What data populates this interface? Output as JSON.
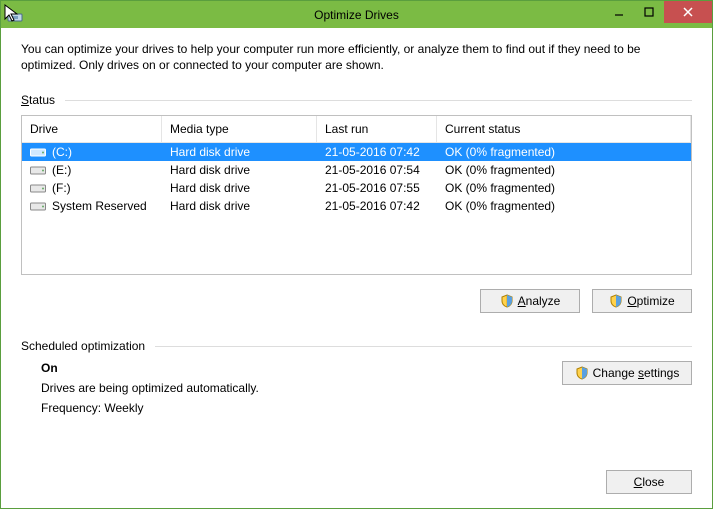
{
  "window": {
    "title": "Optimize Drives"
  },
  "intro": "You can optimize your drives to help your computer run more efficiently, or analyze them to find out if they need to be optimized. Only drives on or connected to your computer are shown.",
  "status_label": "Status",
  "columns": {
    "drive": "Drive",
    "media": "Media type",
    "last": "Last run",
    "status": "Current status"
  },
  "drives": [
    {
      "name": "(C:)",
      "media": "Hard disk drive",
      "last": "21-05-2016 07:42",
      "status": "OK (0% fragmented)",
      "selected": true
    },
    {
      "name": "(E:)",
      "media": "Hard disk drive",
      "last": "21-05-2016 07:54",
      "status": "OK (0% fragmented)",
      "selected": false
    },
    {
      "name": "(F:)",
      "media": "Hard disk drive",
      "last": "21-05-2016 07:55",
      "status": "OK (0% fragmented)",
      "selected": false
    },
    {
      "name": "System Reserved",
      "media": "Hard disk drive",
      "last": "21-05-2016 07:42",
      "status": "OK (0% fragmented)",
      "selected": false
    }
  ],
  "buttons": {
    "analyze_pre": "",
    "analyze_u": "A",
    "analyze_post": "nalyze",
    "optimize_pre": "",
    "optimize_u": "O",
    "optimize_post": "ptimize",
    "change_pre": "Change ",
    "change_u": "s",
    "change_post": "ettings",
    "close_pre": "",
    "close_u": "C",
    "close_post": "lose"
  },
  "scheduled": {
    "label": "Scheduled optimization",
    "state": "On",
    "desc": "Drives are being optimized automatically.",
    "freq": "Frequency: Weekly"
  },
  "colors": {
    "titlebar": "#7bbb44",
    "close": "#c75050",
    "selection": "#1e90ff"
  }
}
